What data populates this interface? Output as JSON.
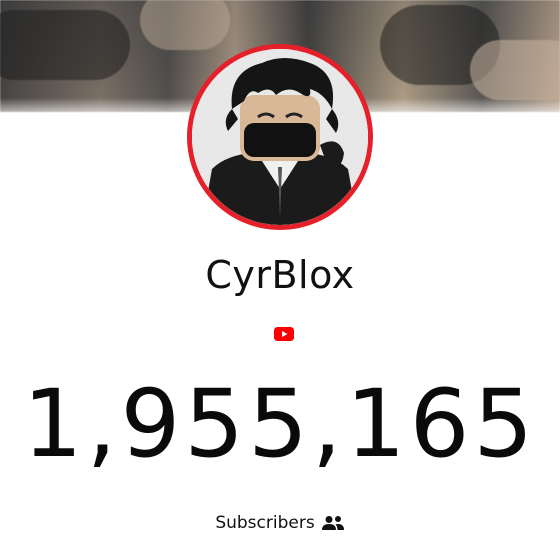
{
  "channel": {
    "name": "CyrBlox",
    "platform_icon": "youtube-play-icon",
    "subscriber_count": "1,955,165",
    "subscribers_label": "Subscribers",
    "subscribers_icon": "people-icon"
  },
  "colors": {
    "avatar_ring": "#e5202a",
    "youtube_red": "#ff0000",
    "text": "#111111",
    "background": "#ffffff"
  }
}
